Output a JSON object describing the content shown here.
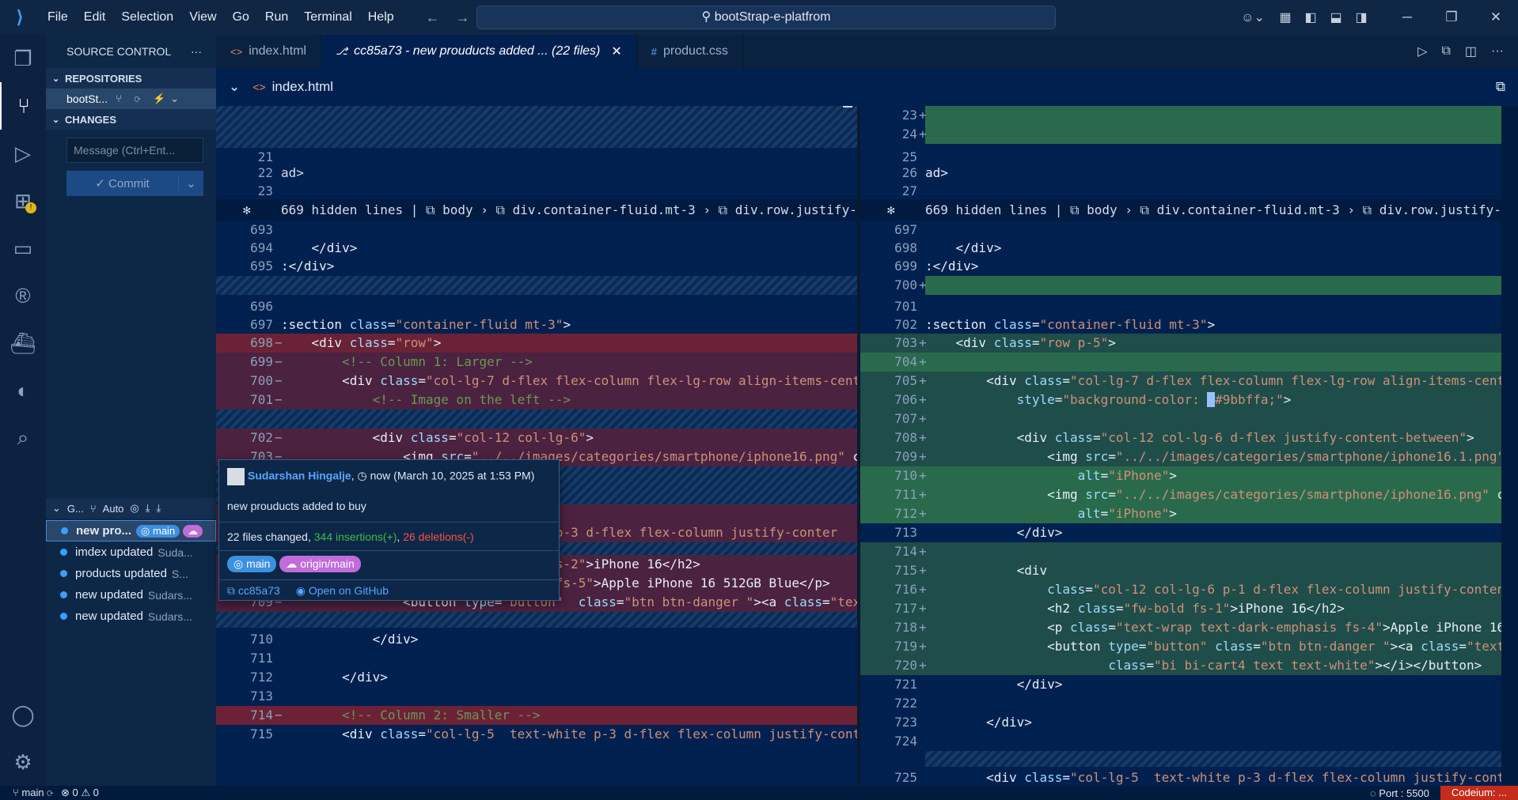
{
  "titlebar": {
    "menu": [
      "File",
      "Edit",
      "Selection",
      "View",
      "Go",
      "Run",
      "Terminal",
      "Help"
    ],
    "search": "bootStrap-e-platfrom"
  },
  "sidebar": {
    "title": "SOURCE CONTROL",
    "repositories_label": "REPOSITORIES",
    "repo_name": "bootSt...",
    "changes_label": "CHANGES",
    "message_placeholder": "Message (Ctrl+Ent...",
    "commit_label": "Commit",
    "graph_title": "G...",
    "graph_auto": "Auto",
    "graph": [
      {
        "msg": "new pro...",
        "author": "",
        "branch": "main",
        "selected": true
      },
      {
        "msg": "imdex updated",
        "author": "Suda..."
      },
      {
        "msg": "products updated",
        "author": "S..."
      },
      {
        "msg": "new updated",
        "author": "Sudars..."
      },
      {
        "msg": "new updated",
        "author": "Sudars..."
      }
    ]
  },
  "tabs": [
    {
      "label": "index.html",
      "icon": "<>",
      "active": false
    },
    {
      "label": "cc85a73 - new prouducts added ... (22 files)",
      "icon": "⎇",
      "active": true
    },
    {
      "label": "product.css",
      "icon": "#",
      "active": false
    }
  ],
  "editor": {
    "breadcrumb_file": "index.html",
    "fold_left": "669 hidden lines  |  ⧉ body  ›  ⧉ div.container-fluid.mt-3  ›  ⧉ div.row.justify-content-center",
    "fold_right": "669 hidden lines  |  ⧉ body  ›  ⧉ div.container-fluid.mt-3  ›  ⧉ div.row.justify-content-center"
  },
  "hover": {
    "author": "Sudarshan Hingalje",
    "time": "now (March 10, 2025 at 1:53 PM)",
    "message": "new prouducts added to buy",
    "summary_prefix": "22 files changed, ",
    "insertions": "344 insertions(+)",
    "deletions": "26 deletions(-)",
    "branch": "main",
    "remote": "origin/main",
    "sha": "cc85a73",
    "open_github": "Open on GitHub"
  },
  "statusbar": {
    "branch": "main",
    "problems": "⊗ 0 ⚠ 0",
    "port": "Port : 5500",
    "codeium": "Codeium: ..."
  },
  "colors": {
    "accent": "#3fa0ff",
    "deleted": "#4b2240",
    "inserted": "#1f4d4a",
    "statusbar_alert": "#c42b1c"
  }
}
